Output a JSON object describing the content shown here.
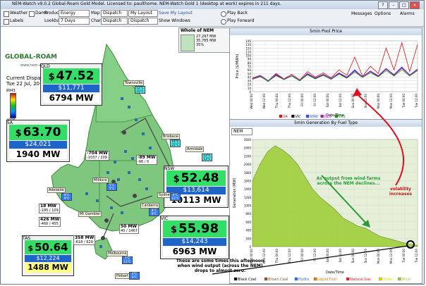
{
  "window": {
    "title": "NEM-Watch v9.0.2 Global-Roam Gold Model.   Licensed to: paulthome.   NEM-Watch Gold 1 (desktop at work) expires in 211 days.",
    "help_label": "?"
  },
  "toolbar": {
    "weather_label": "Weather",
    "product_label": "Product",
    "product_value": "Energy",
    "map_label": "Map",
    "map_value": "Dispatch",
    "layout_value": "My Layout",
    "save_layout": "Save My Layout",
    "playback": "Play Back",
    "labels_label": "Labels",
    "lookback_label": "Lookback",
    "lookback_value": "7 Days",
    "charts_label": "Charts",
    "charts_value": "Dispatch",
    "charts2_value": "Dispatch",
    "show_windows": "Show Windows",
    "play_forward": "Play Forward",
    "messages": "Messages",
    "options": "Options",
    "alarms": "Alarms",
    "dams_label": "Dams"
  },
  "header": {
    "logo": "GLOBAL-ROAM",
    "url": "www.nem-watch.info",
    "dispatch_label": "Current Dispatch:",
    "dispatch_time": "Tue 22 Jul, 2014 20:35",
    "scale_max": "8943",
    "scale_min": "4006"
  },
  "whole_nem": {
    "title": "Whole of NEM",
    "line1": "27,297 MW",
    "line2": "35,785 MW",
    "line3": "35%"
  },
  "regions": {
    "qld": {
      "name": "QLD",
      "price": "47.52",
      "subprice": "$11,771",
      "mw": "6794 MW",
      "color": "#33dd66"
    },
    "sa": {
      "name": "SA",
      "price": "63.70",
      "subprice": "$24,021",
      "mw": "1940 MW",
      "color": "#33dd66"
    },
    "nsw": {
      "name": "NSW",
      "price": "52.48",
      "subprice": "$13,614",
      "mw": "10113 MW",
      "color": "#33dd66"
    },
    "vic": {
      "name": "VIC",
      "price": "55.98",
      "subprice": "$14,243",
      "mw": "6963 MW",
      "color": "#33dd66"
    },
    "tas": {
      "name": "TAS",
      "price": "50.64",
      "subprice": "$12,224",
      "mw": "1488 MW",
      "color": "#33dd66"
    }
  },
  "flows": {
    "f1": "-704 MW",
    "f1b": "-1037 / 209",
    "f2": "-89 MW",
    "f2b": "-96 / 0",
    "f3": "18 MW",
    "f3b": "-185 / 109",
    "f4": "426 MW",
    "f4b": "-460 / 455",
    "f5": "358 MW",
    "f5b": "-618 / 629",
    "f6": "50 MW",
    "f6b": "40 / 1467"
  },
  "cities": {
    "townsville": "Townsville",
    "brisbane": "Brisbane",
    "armidale": "Armidale",
    "mildura": "Mildura",
    "adelaide": "Adelaide",
    "canberra": "Canberra",
    "melbourne": "Melbourne",
    "hobart": "Hobart",
    "mtgambier": "Mt Gambier",
    "sydney": "Sydney"
  },
  "temps": {
    "t1": "12°C\n15°C",
    "t2": "14°C\n21°C",
    "t3": "12°C\n13°C",
    "t4": "5°C\n5°C",
    "t5": "8°C\n9°C",
    "t6": "8°C\n9°C",
    "t7": "7°C\n11°C",
    "t8": "4°C\n9°C",
    "t9": "6°C\n12°C"
  },
  "price_chart": {
    "panel_title": "5min Pool Price",
    "chart_data": {
      "type": "line",
      "ylabel": "Price ($/MWh)",
      "xlabel": "Date/Time",
      "ylim": [
        0,
        140
      ],
      "yticks": [
        0,
        10,
        20,
        30,
        40,
        50,
        60,
        70,
        80,
        90,
        100,
        110,
        120,
        130,
        140
      ],
      "xticks": [
        "Wed 00:00",
        "Wed 12:00",
        "Thu 00:00",
        "Thu 12:00",
        "Fri 00:00",
        "Fri 12:00",
        "Sat 00:00",
        "Sat 12:00",
        "Sun 00:00",
        "Sun 12:00",
        "Mon 00:00",
        "Mon 12:00",
        "Tue 00:00",
        "Tue 12:00"
      ],
      "series": [
        {
          "name": "SA",
          "color": "#e01010",
          "values": [
            38,
            45,
            30,
            50,
            35,
            48,
            32,
            55,
            40,
            52,
            38,
            60,
            45,
            95,
            42,
            70,
            50,
            120,
            60,
            135,
            55,
            130
          ]
        },
        {
          "name": "VIC",
          "color": "#101010",
          "values": [
            34,
            42,
            28,
            46,
            33,
            44,
            30,
            48,
            36,
            46,
            34,
            50,
            38,
            58,
            40,
            55,
            42,
            62,
            45,
            65,
            45,
            60
          ]
        },
        {
          "name": "NSW",
          "color": "#3050ff",
          "values": [
            36,
            44,
            30,
            48,
            34,
            45,
            31,
            50,
            38,
            48,
            36,
            52,
            40,
            60,
            41,
            57,
            44,
            64,
            47,
            68,
            46,
            62
          ]
        },
        {
          "name": "QLD",
          "color": "#c010c0",
          "values": [
            35,
            43,
            29,
            47,
            34,
            44,
            30,
            49,
            37,
            47,
            35,
            51,
            39,
            57,
            40,
            56,
            43,
            63,
            46,
            66,
            45,
            61
          ]
        },
        {
          "name": "TAS",
          "color": "#109010",
          "values": [
            34,
            41,
            29,
            44,
            33,
            43,
            30,
            46,
            35,
            45,
            34,
            48,
            37,
            54,
            39,
            52,
            41,
            58,
            43,
            60,
            43,
            58
          ]
        }
      ]
    },
    "legend": [
      "SA",
      "VIC",
      "NSW",
      "QLD",
      "TAS"
    ]
  },
  "gen_chart": {
    "panel_title": "5min Generation By Fuel Type",
    "selector": "NEM",
    "chart_data": {
      "type": "area",
      "ylabel": "Generation (MW)",
      "xlabel": "Date/Time",
      "ylim": [
        0,
        2600
      ],
      "yticks": [
        0,
        200,
        400,
        600,
        800,
        1000,
        1200,
        1400,
        1600,
        1800,
        2000,
        2200,
        2400,
        2600
      ],
      "xticks": [
        "Wed 00:00",
        "Wed 12:00",
        "Thu 00:00",
        "Thu 12:00",
        "Fri 00:00",
        "Fri 12:00",
        "Sat 00:00",
        "Sat 12:00",
        "Sun 00:00",
        "Sun 12:00",
        "Mon 00:00",
        "Mon 12:00",
        "Tue 00:00",
        "Tue 12:00"
      ],
      "series": [
        {
          "name": "Wind",
          "color": "#9acd32",
          "values": [
            1600,
            2000,
            2300,
            2450,
            2350,
            2200,
            2000,
            1700,
            1400,
            1200,
            1050,
            900,
            700,
            600,
            500,
            450,
            350,
            250,
            200,
            150,
            100,
            60,
            30
          ]
        }
      ]
    },
    "legend": [
      "Black Coal",
      "Brown Coal",
      "Hydro",
      "Liquid Fuel",
      "Natural Gas",
      "Other",
      "Wind"
    ]
  },
  "annotations": {
    "wind_text": "As output from wind farms across the NEM declines...",
    "volatility": "volatility increases",
    "zero_text": "These are some times this afternoon when wind output (across the NEM) drops to almost zero."
  }
}
